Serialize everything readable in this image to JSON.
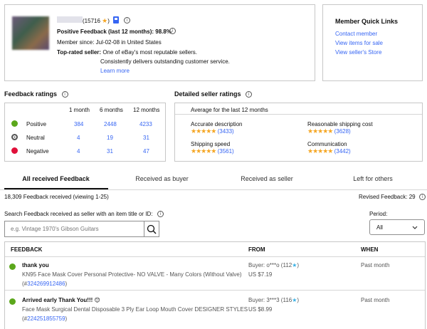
{
  "profile": {
    "score": "(15716",
    "score_close": ")",
    "positive_feedback": "Positive Feedback (last 12 months): 98.8%",
    "member_since": "Member since: Jul-02-08 in United States",
    "top_rated_label": "Top-rated seller:",
    "top_rated_text": "One of eBay's most reputable sellers.",
    "top_rated_text2": "Consistently delivers outstanding customer service.",
    "learn_more": "Learn more"
  },
  "quick_links": {
    "title": "Member Quick Links",
    "items": [
      "Contact member",
      "View items for sale",
      "View seller's Store"
    ]
  },
  "feedback_ratings": {
    "title": "Feedback ratings",
    "columns": [
      "1 month",
      "6 months",
      "12 months"
    ],
    "rows": [
      {
        "label": "Positive",
        "values": [
          "384",
          "2448",
          "4233"
        ]
      },
      {
        "label": "Neutral",
        "values": [
          "4",
          "19",
          "31"
        ]
      },
      {
        "label": "Negative",
        "values": [
          "4",
          "31",
          "47"
        ]
      }
    ]
  },
  "detailed_ratings": {
    "title": "Detailed seller ratings",
    "subtitle": "Average for the last 12 months",
    "items": [
      {
        "label": "Accurate description",
        "count": "(3433)"
      },
      {
        "label": "Reasonable shipping cost",
        "count": "(3628)"
      },
      {
        "label": "Shipping speed",
        "count": "(3561)"
      },
      {
        "label": "Communication",
        "count": "(3442)"
      }
    ],
    "stars": "★★★★★"
  },
  "tabs": [
    "All received Feedback",
    "Received as buyer",
    "Received as seller",
    "Left for others"
  ],
  "summary": {
    "received": "18,309 Feedback received (viewing 1-25)",
    "revised": "Revised Feedback: 29"
  },
  "search": {
    "label": "Search Feedback received as seller with an item title or ID:",
    "placeholder": "e.g. Vintage 1970's Gibson Guitars",
    "period_label": "Period:",
    "period_value": "All"
  },
  "table": {
    "headers": [
      "FEEDBACK",
      "FROM",
      "WHEN"
    ],
    "rows": [
      {
        "comment": "thank you",
        "item": "KN95 Face Mask Cover Personal Protective- NO VALVE - Many Colors (Without Valve)",
        "item_id": "324269912486",
        "buyer": "Buyer: o***o (112",
        "price": "US $7.19",
        "when": "Past month"
      },
      {
        "comment": "Arrived early Thank You!!! 😊",
        "item": "Face Mask Surgical Dental Disposable 3 Ply Ear Loop Mouth Cover DESIGNER STYLES",
        "item_id": "224251855759",
        "buyer": "Buyer: 3***3 (116",
        "price": "US $8.99",
        "when": "Past month"
      }
    ]
  }
}
